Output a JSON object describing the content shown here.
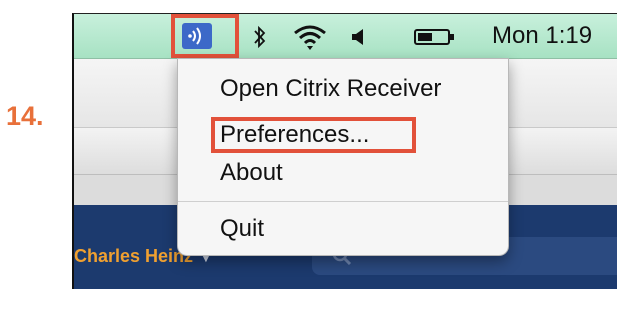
{
  "step": {
    "number": "14."
  },
  "menubar": {
    "clock": "Mon 1:19",
    "icons": [
      "citrix-receiver-icon",
      "bluetooth-icon",
      "wifi-icon",
      "volume-icon",
      "battery-icon"
    ]
  },
  "menu": {
    "items": [
      "Open Citrix Receiver",
      "Preferences...",
      "About",
      "Quit"
    ]
  },
  "background": {
    "user_name": "Charles Heinz"
  },
  "colors": {
    "highlight": "#e2513a",
    "step_label": "#e8703a",
    "menubar": "#b3e7cc",
    "citrix_icon": "#3c69c8",
    "dark_panel": "#1c3a6e",
    "user_name": "#f0a030"
  }
}
